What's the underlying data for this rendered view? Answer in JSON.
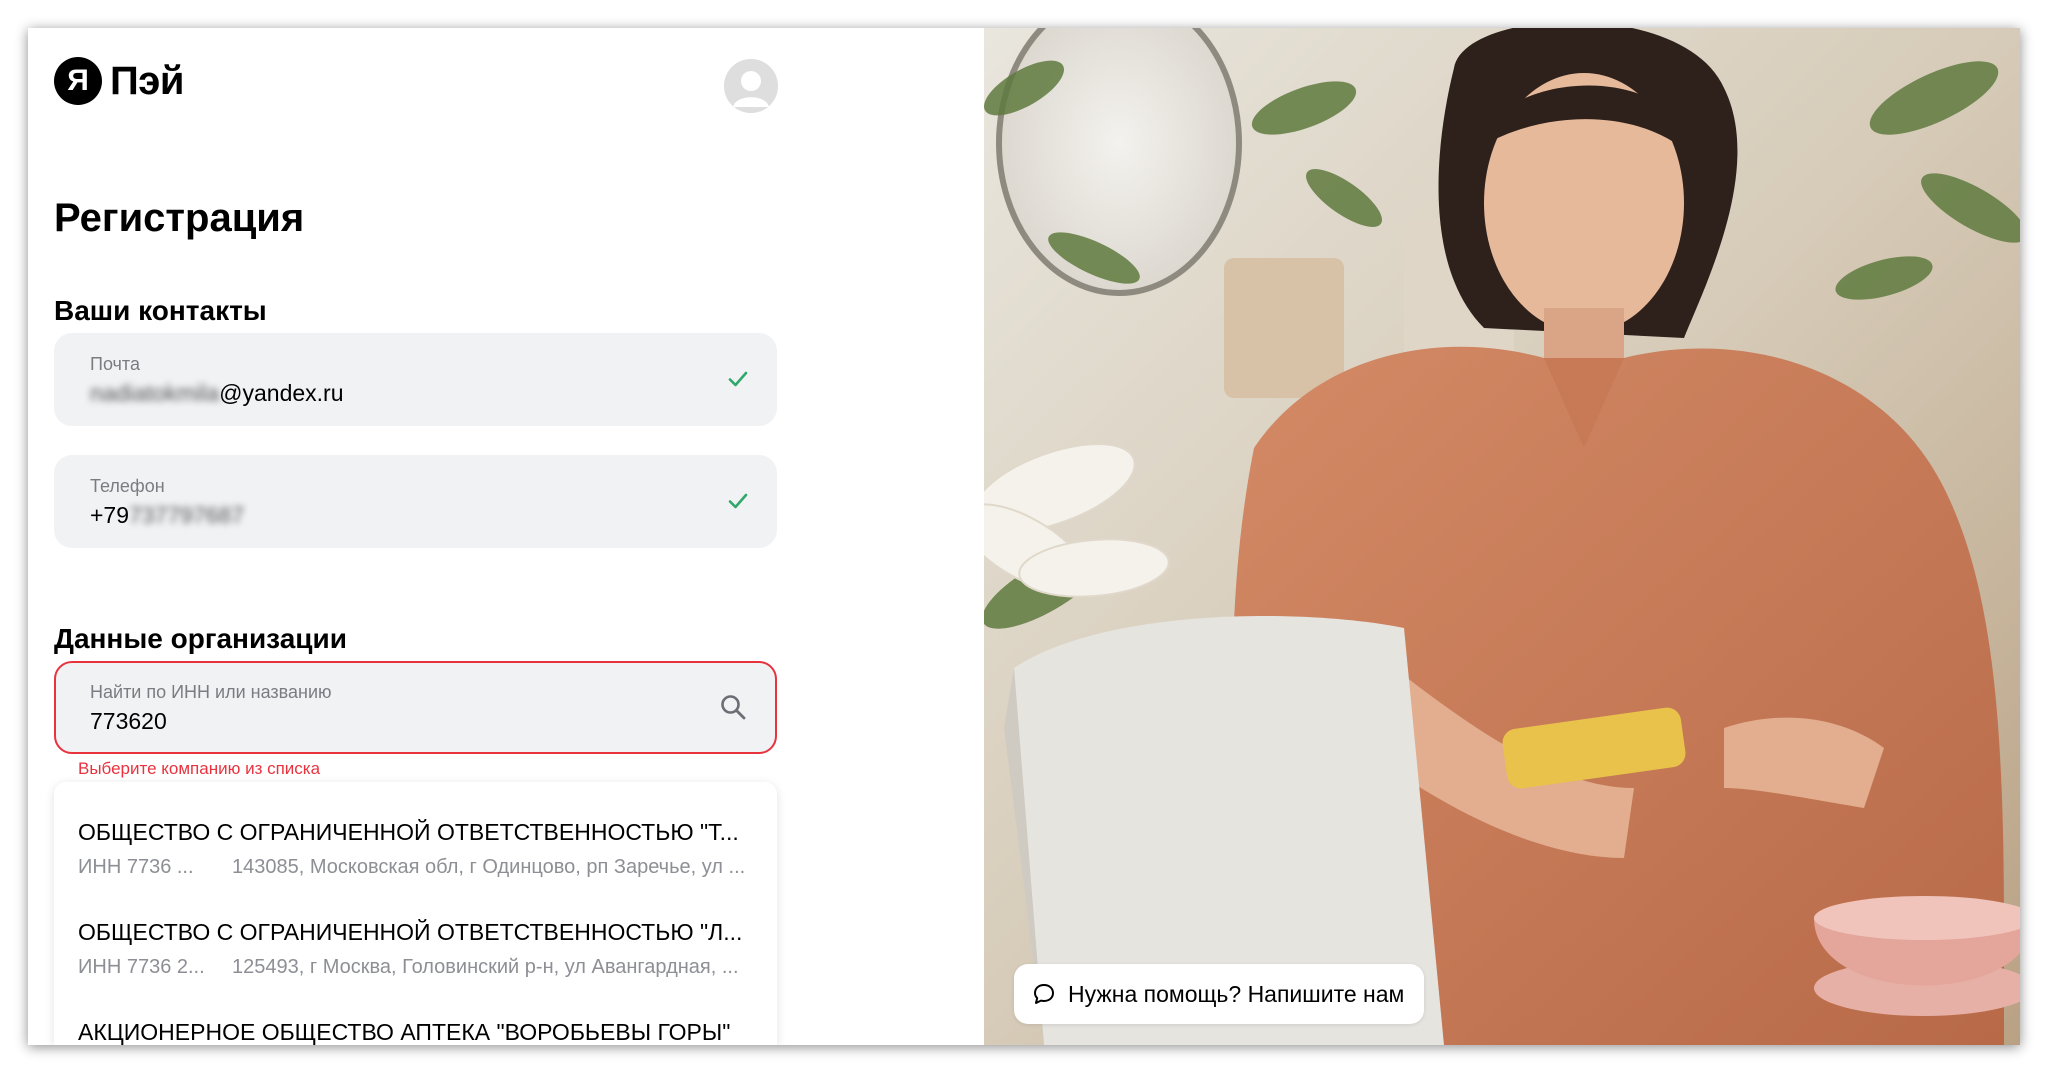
{
  "brand": {
    "mark": "Я",
    "name": "Пэй"
  },
  "page": {
    "title": "Регистрация"
  },
  "contacts": {
    "heading": "Ваши контакты",
    "email": {
      "label": "Почта",
      "value_hidden": "nadiatokmila",
      "value_visible": "@yandex.ru",
      "status": "valid"
    },
    "phone": {
      "label": "Телефон",
      "value_visible": "+79",
      "value_hidden": "737797687",
      "status": "valid"
    }
  },
  "organization": {
    "heading": "Данные организации",
    "search": {
      "label": "Найти по ИНН или названию",
      "value": "773620"
    },
    "error": "Выберите компанию из списка",
    "results": [
      {
        "name": "ОБЩЕСТВО С ОГРАНИЧЕННОЙ ОТВЕТСТВЕННОСТЬЮ \"Т...",
        "inn": "ИНН 7736 ...",
        "address": "143085, Московская обл, г Одинцово, рп Заречье, ул ..."
      },
      {
        "name": "ОБЩЕСТВО С ОГРАНИЧЕННОЙ ОТВЕТСТВЕННОСТЬЮ \"Л...",
        "inn": "ИНН 7736 2...",
        "address": "125493, г Москва, Головинский р-н, ул Авангардная, ..."
      },
      {
        "name": "АКЦИОНЕРНОЕ ОБЩЕСТВО АПТЕКА \"ВОРОБЬЕВЫ ГОРЫ\"",
        "inn": "",
        "address": ""
      }
    ]
  },
  "help": {
    "label": "Нужна помощь? Напишите нам"
  },
  "colors": {
    "error": "#e8333f",
    "success": "#2fa86a",
    "field_bg": "#f1f2f4"
  }
}
